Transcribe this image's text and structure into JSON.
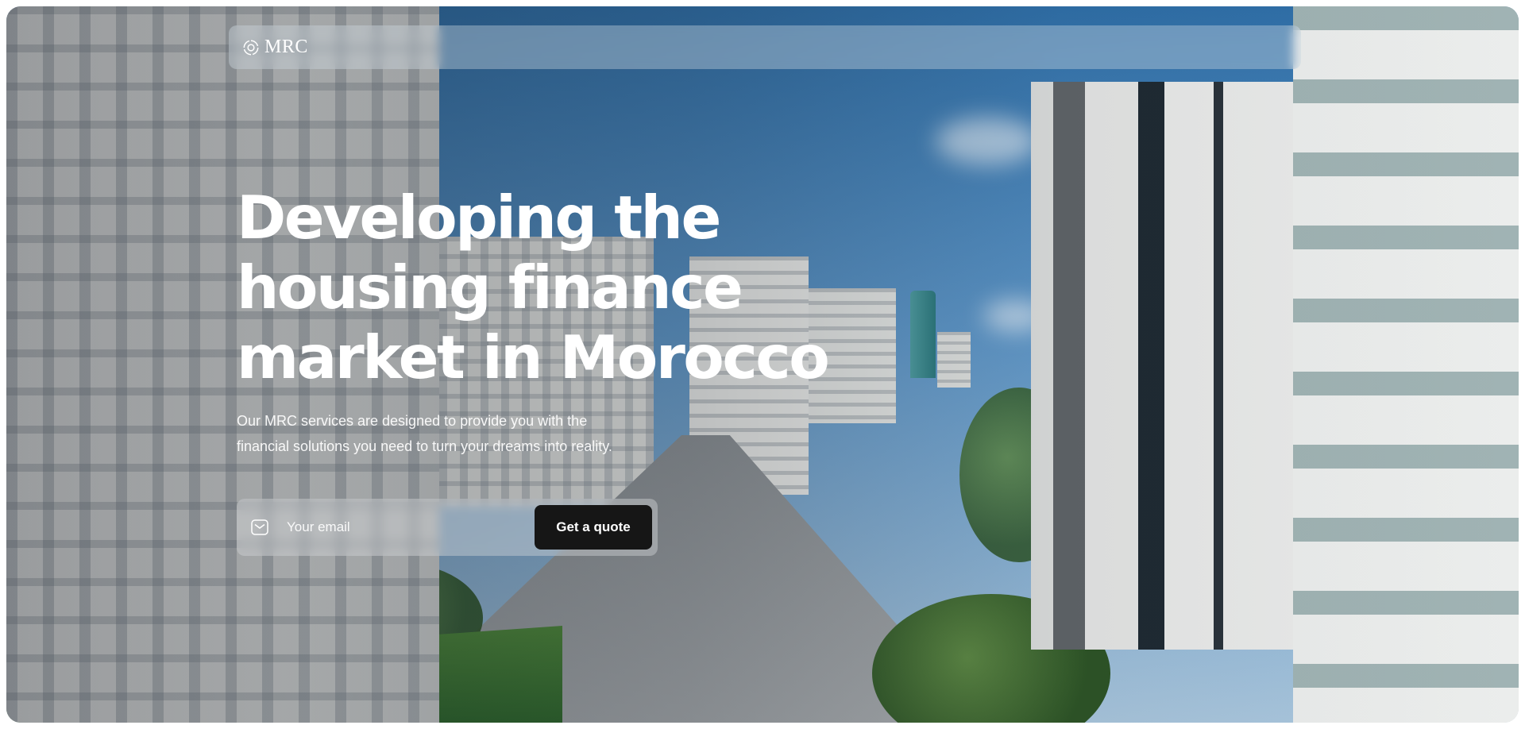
{
  "brand": {
    "logo_text": "MRC",
    "logo_icon": "mrc-swirl-logo-icon"
  },
  "hero": {
    "headline_lines": [
      "Developing the",
      "housing finance",
      "market in Morocco"
    ],
    "subtitle_lines": [
      "Our MRC services are designed to provide you with the",
      "financial solutions you need to turn your dreams into reality."
    ]
  },
  "form": {
    "email_icon": "mail-icon",
    "email_placeholder": "Your email",
    "cta_label": "Get a quote"
  },
  "background": {
    "image_subject": "aerial street view with high-rise residential towers and palm trees"
  },
  "colors": {
    "headline": "#ffffff",
    "cta_background": "#161616",
    "cta_text": "#ffffff"
  }
}
